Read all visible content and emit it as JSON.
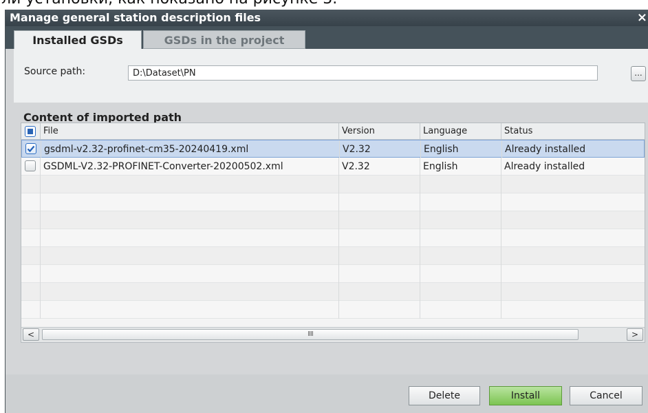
{
  "background_text": "ли установки, как показано на рисунке 3.",
  "window": {
    "title": "Manage general station description files",
    "close_glyph": "×"
  },
  "tabs": [
    {
      "label": "Installed GSDs",
      "active": true
    },
    {
      "label": "GSDs in the project",
      "active": false
    }
  ],
  "source": {
    "label": "Source path:",
    "value": "D:\\Dataset\\PN",
    "browse_label": "..."
  },
  "content": {
    "title": "Content of imported path",
    "columns": [
      "File",
      "Version",
      "Language",
      "Status"
    ],
    "rows": [
      {
        "checked": true,
        "selected": true,
        "file": "gsdml-v2.32-profinet-cm35-20240419.xml",
        "version": "V2.32",
        "language": "English",
        "status": "Already installed"
      },
      {
        "checked": false,
        "selected": false,
        "file": "GSDML-V2.32-PROFINET-Converter-20200502.xml",
        "version": "V2.32",
        "language": "English",
        "status": "Already installed"
      }
    ],
    "scroll_left_glyph": "<",
    "scroll_right_glyph": ">",
    "scroll_thumb_glyph": "IIII"
  },
  "buttons": {
    "delete": "Delete",
    "install": "Install",
    "cancel": "Cancel"
  },
  "colors": {
    "title_bar": "#37424a",
    "selection": "#c9d9ef",
    "install_accent": "#7cc451",
    "checkbox_accent": "#2f6fc4"
  }
}
